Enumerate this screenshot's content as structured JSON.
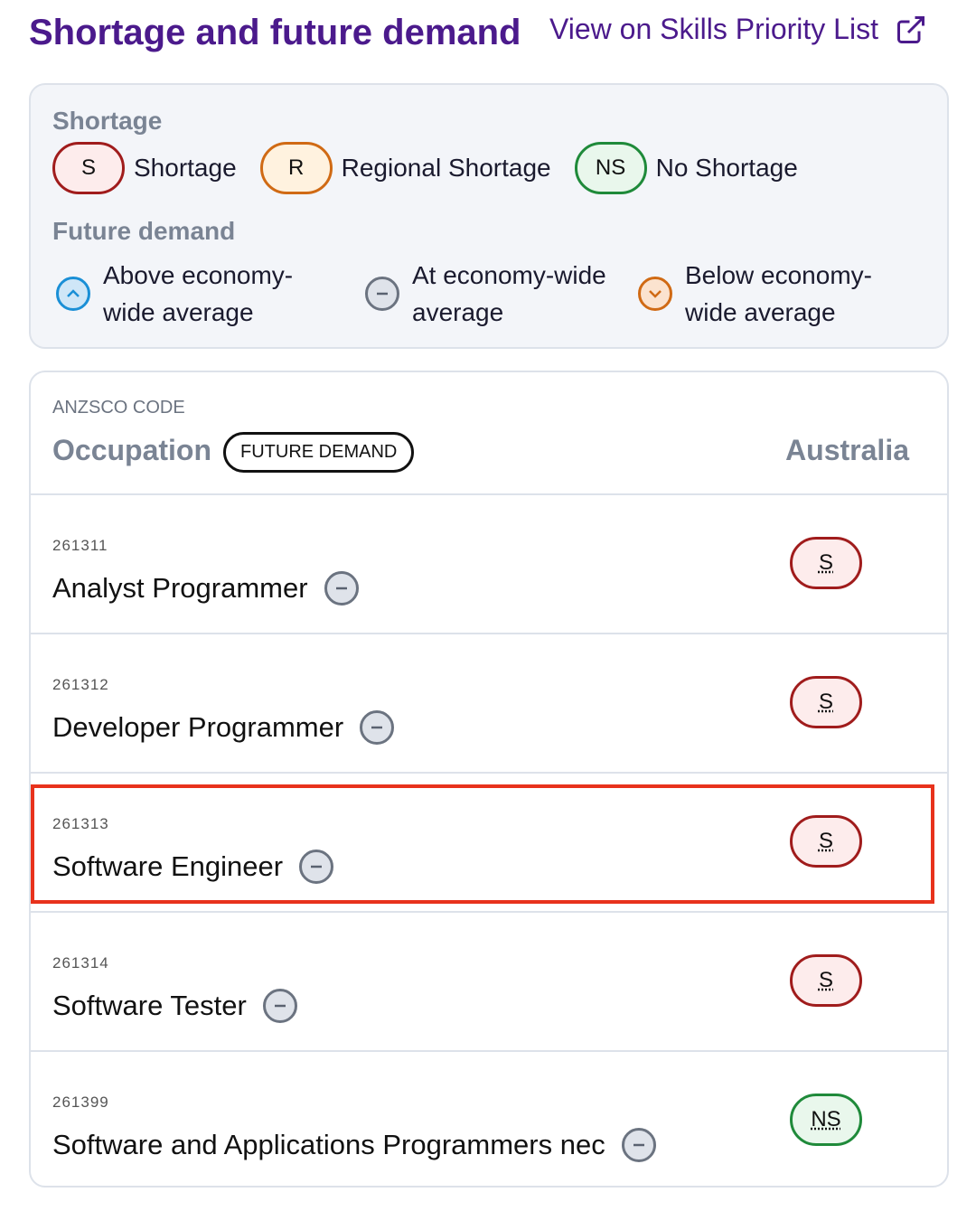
{
  "header": {
    "title": "Shortage and future demand",
    "link_label": "View on Skills Priority List",
    "link_icon": "external-link-icon"
  },
  "legend": {
    "shortage_heading": "Shortage",
    "shortage_items": [
      {
        "code": "S",
        "label": "Shortage",
        "color": "#a01c1c"
      },
      {
        "code": "R",
        "label": "Regional Shortage",
        "color": "#d06a14"
      },
      {
        "code": "NS",
        "label": "No Shortage",
        "color": "#1f8a3a"
      }
    ],
    "demand_heading": "Future demand",
    "demand_items": [
      {
        "icon": "chevron-up-circle-icon",
        "label": "Above economy-wide average"
      },
      {
        "icon": "minus-circle-icon",
        "label": "At economy-wide average"
      },
      {
        "icon": "chevron-down-circle-icon",
        "label": "Below economy-wide average"
      }
    ]
  },
  "table": {
    "code_header": "ANZSCO CODE",
    "occupation_header": "Occupation",
    "future_demand_badge": "FUTURE DEMAND",
    "region_header": "Australia",
    "rows": [
      {
        "code": "261311",
        "name": "Analyst Programmer",
        "demand": "at",
        "shortage": "S"
      },
      {
        "code": "261312",
        "name": "Developer Programmer",
        "demand": "at",
        "shortage": "S"
      },
      {
        "code": "261313",
        "name": "Software Engineer",
        "demand": "at",
        "shortage": "S",
        "highlighted": true
      },
      {
        "code": "261314",
        "name": "Software Tester",
        "demand": "at",
        "shortage": "S"
      },
      {
        "code": "261399",
        "name": "Software and Applications Programmers nec",
        "demand": "at",
        "shortage": "NS"
      }
    ]
  }
}
